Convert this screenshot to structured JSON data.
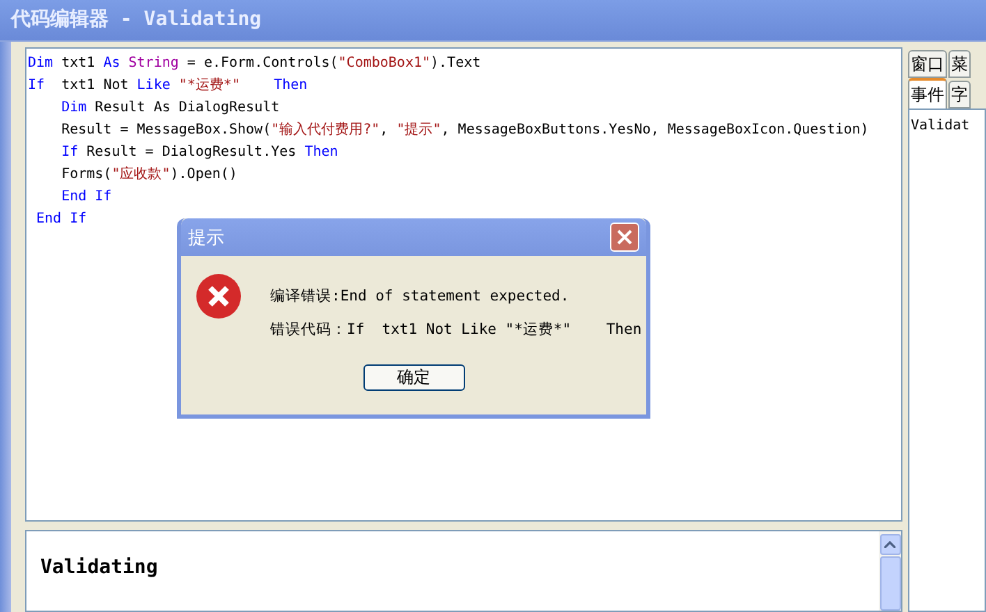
{
  "window": {
    "title": "代码编辑器 - Validating"
  },
  "code_lines": [
    [
      {
        "kind": "kw",
        "text": "Dim"
      },
      {
        "kind": "plain",
        "text": " txt1 "
      },
      {
        "kind": "kw",
        "text": "As"
      },
      {
        "kind": "type",
        "text": " String"
      },
      {
        "kind": "plain",
        "text": " = e.Form.Controls("
      },
      {
        "kind": "str",
        "text": "\"ComboBox1\""
      },
      {
        "kind": "plain",
        "text": ").Text"
      }
    ],
    [
      {
        "kind": "kw",
        "text": "If"
      },
      {
        "kind": "plain",
        "text": "  txt1 Not "
      },
      {
        "kind": "kw",
        "text": "Like"
      },
      {
        "kind": "str",
        "text": " \"*运费*\""
      },
      {
        "kind": "kw",
        "text": "    Then"
      }
    ],
    [
      {
        "kind": "kw",
        "text": "    Dim"
      },
      {
        "kind": "plain",
        "text": " Result As DialogResult"
      }
    ],
    [
      {
        "kind": "plain",
        "text": "    Result = MessageBox.Show("
      },
      {
        "kind": "str",
        "text": "\"输入代付费用?\""
      },
      {
        "kind": "plain",
        "text": ", "
      },
      {
        "kind": "str",
        "text": "\"提示\""
      },
      {
        "kind": "plain",
        "text": ", MessageBoxButtons.YesNo, MessageBoxIcon.Question)"
      }
    ],
    [
      {
        "kind": "kw",
        "text": "    If"
      },
      {
        "kind": "plain",
        "text": " Result = DialogResult.Yes "
      },
      {
        "kind": "kw",
        "text": "Then"
      }
    ],
    [
      {
        "kind": "plain",
        "text": "    Forms("
      },
      {
        "kind": "str",
        "text": "\"应收款\""
      },
      {
        "kind": "plain",
        "text": ").Open()"
      }
    ],
    [
      {
        "kind": "kw",
        "text": "    End If"
      }
    ],
    [
      {
        "kind": "kw",
        "text": " End If"
      }
    ]
  ],
  "help": {
    "title": "Validating"
  },
  "side_tabs_top": [
    {
      "label": "窗口",
      "selected": false
    },
    {
      "label": "菜",
      "selected": false
    }
  ],
  "side_tabs": [
    {
      "label": "事件",
      "selected": true
    },
    {
      "label": "字",
      "selected": false
    }
  ],
  "side_list": [
    "Validat"
  ],
  "dialog": {
    "title": "提示",
    "message": "编译错误:End of statement expected.",
    "code": "错误代码：If  txt1 Not Like \"*运费*\"    Then",
    "button": "确定"
  }
}
